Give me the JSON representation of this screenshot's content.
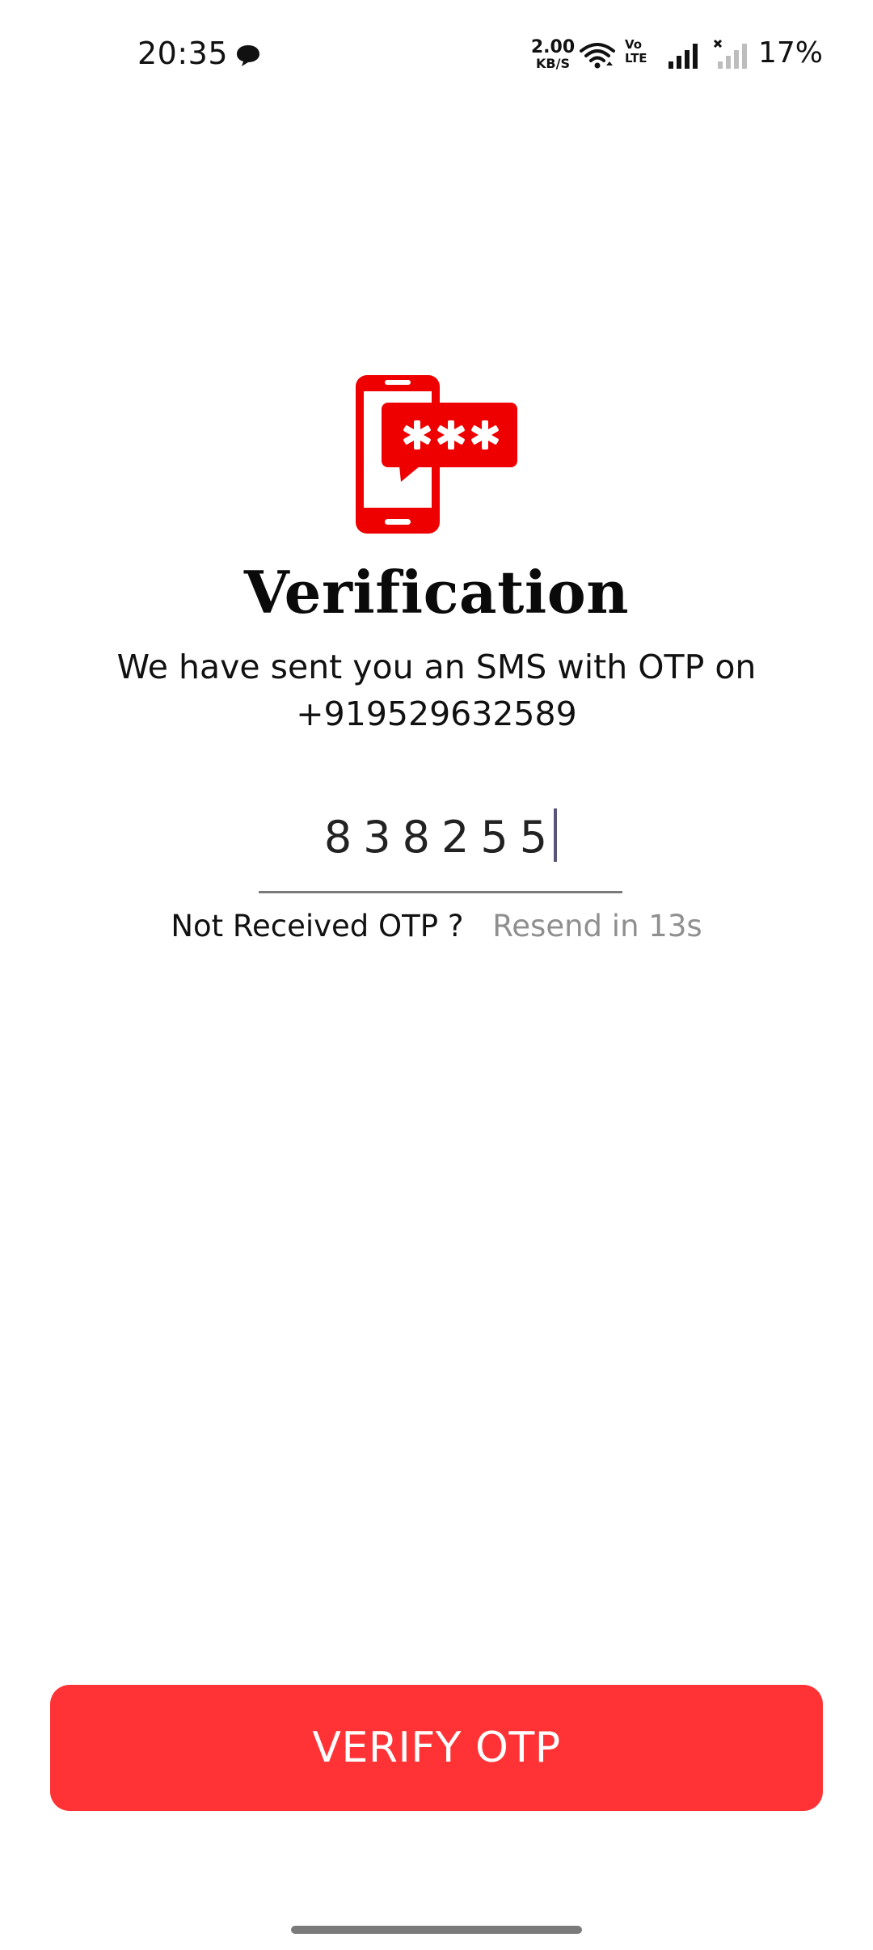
{
  "status_bar": {
    "time": "20:35",
    "net_speed_value": "2.00",
    "net_speed_unit": "KB/S",
    "volte_line1": "Vo",
    "volte_line2": "LTE",
    "battery": "17%"
  },
  "verification": {
    "icon": "otp-phone-icon",
    "title": "Verification",
    "subtitle_line1": "We have sent you an SMS with OTP on",
    "phone_number": "+919529632589",
    "otp_value": "838255",
    "not_received_label": "Not Received OTP ?",
    "resend_label": "Resend in 13s"
  },
  "actions": {
    "verify_label": "VERIFY OTP"
  },
  "colors": {
    "accent": "#ff3336",
    "icon_red": "#ee0000",
    "muted_text": "#8f8f8f"
  }
}
